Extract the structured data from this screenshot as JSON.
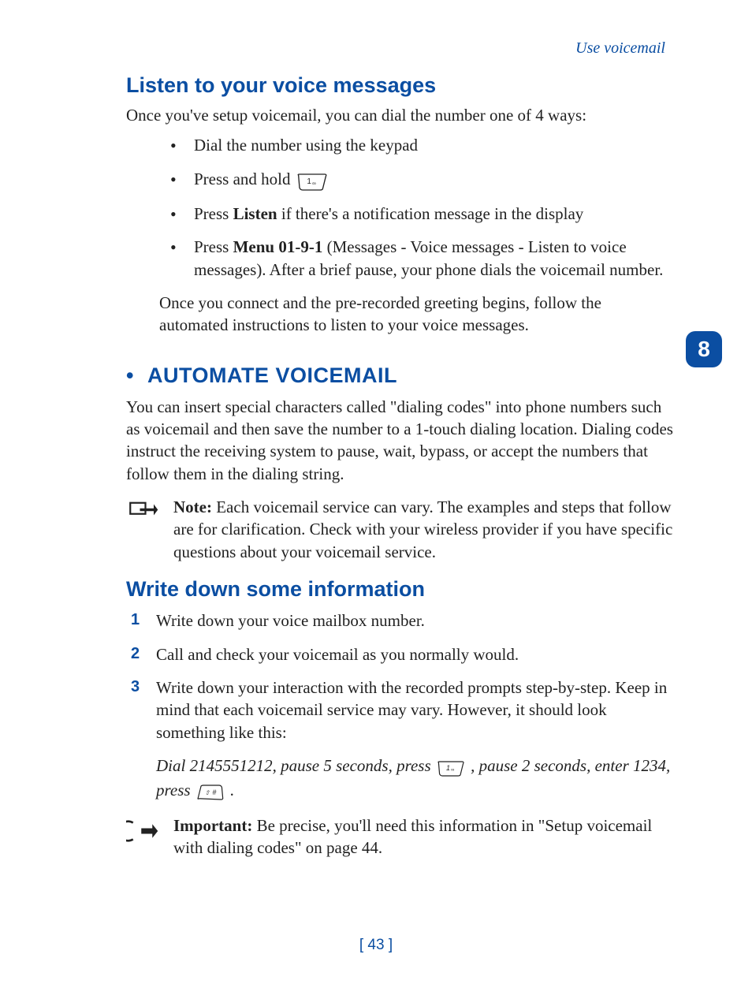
{
  "header_link": "Use voicemail",
  "section_tab": "8",
  "page_number": "[ 43 ]",
  "s1": {
    "title": "Listen to your voice messages",
    "intro": "Once you've setup voicemail, you can dial the number one of 4 ways:",
    "b1": "Dial the number using the keypad",
    "b2a": "Press and hold ",
    "b3a": "Press ",
    "b3b": "Listen",
    "b3c": " if there's a notification message in the display",
    "b4a": "Press ",
    "b4b": "Menu 01-9-1",
    "b4c": " (Messages - Voice messages - Listen to voice messages). After a brief pause, your phone dials the voicemail number.",
    "followup": "Once you connect and the pre-recorded greeting begins, follow the automated instructions to listen to your voice messages."
  },
  "s2": {
    "title": " AUTOMATE VOICEMAIL",
    "intro": "You can insert special characters called \"dialing codes\" into phone numbers such as voicemail and then save the number to a 1-touch dialing location. Dialing codes instruct the receiving system to pause, wait, bypass, or accept the numbers that follow them in the dialing string.",
    "note_label": "Note:",
    "note_body": " Each voicemail service can vary. The examples and steps that follow are for clarification. Check with your wireless provider if you have specific questions about your voicemail service."
  },
  "s3": {
    "title": "Write down some information",
    "step1": "Write down your voice mailbox number.",
    "step2": "Call and check your voicemail as you normally would.",
    "step3": "Write down your interaction with the recorded prompts step-by-step. Keep in mind that each voicemail service may vary. However, it should look something like this:",
    "example_a": "Dial 2145551212, pause 5 seconds, press ",
    "example_b": " , pause 2 seconds, enter 1234, press ",
    "example_c": " .",
    "important_label": "Important:",
    "important_body": " Be precise, you'll need this information in \"Setup voicemail with dialing codes\" on page 44."
  }
}
